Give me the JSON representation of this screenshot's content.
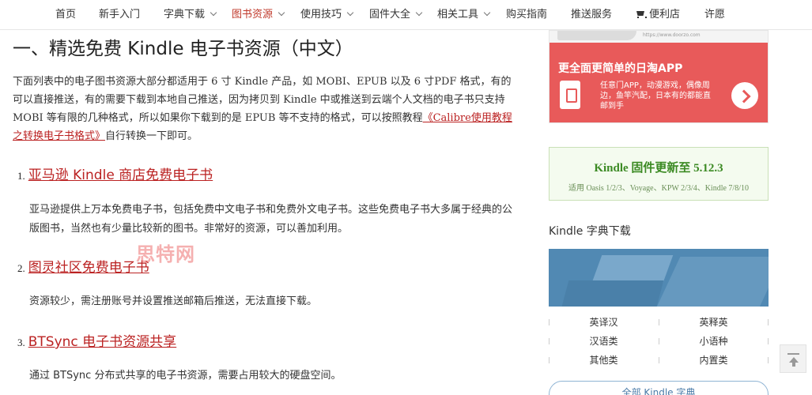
{
  "nav": {
    "items": [
      {
        "label": "首页",
        "dropdown": false,
        "active": false
      },
      {
        "label": "新手入门",
        "dropdown": false,
        "active": false
      },
      {
        "label": "字典下载",
        "dropdown": true,
        "active": false
      },
      {
        "label": "图书资源",
        "dropdown": true,
        "active": true
      },
      {
        "label": "使用技巧",
        "dropdown": true,
        "active": false
      },
      {
        "label": "固件大全",
        "dropdown": true,
        "active": false
      },
      {
        "label": "相关工具",
        "dropdown": true,
        "active": false
      },
      {
        "label": "购买指南",
        "dropdown": false,
        "active": false
      },
      {
        "label": "推送服务",
        "dropdown": false,
        "active": false
      },
      {
        "label": "便利店",
        "dropdown": false,
        "active": false,
        "icon": "cart-icon"
      },
      {
        "label": "许愿",
        "dropdown": false,
        "active": false
      }
    ]
  },
  "article": {
    "heading": "一、精选免费 Kindle 电子书资源（中文）",
    "intro_1": "下面列表中的电子图书资源大部分都适用于 6 寸 Kindle 产品，如 MOBI、EPUB 以及 6 寸PDF 格式，有的可以直接推送，有的需要下载到本地自己推送，因为拷贝到 Kindle 中或推送到云端个人文档的电子书只支持 MOBI 等有限的几种格式，所以如果你下载到的是 EPUB 等不支持的格式，可以按照教程",
    "intro_link": "《Calibre使用教程之转换电子书格式》",
    "intro_2": "自行转换一下即可。",
    "sections": [
      {
        "num": "1.",
        "title": "亚马逊 Kindle 商店免费电子书",
        "body": "亚马逊提供上万本免费电子书，包括免费中文电子书和免费外文电子书。这些免费电子书大多属于经典的公版图书，当然也有少量比较新的图书。非常好的资源，可以善加利用。"
      },
      {
        "num": "2.",
        "title": "图灵社区免费电子书",
        "body": "资源较少，需注册账号并设置推送邮箱后推送，无法直接下载。"
      },
      {
        "num": "3.",
        "title": "BTSync 电子书资源共享",
        "body": "通过 BTSync 分布式共享的电子书资源，需要占用较大的硬盘空间。"
      }
    ],
    "watermark": "思特网"
  },
  "sidebar": {
    "ad": {
      "top_url": "https://www.doorzo.com",
      "title": "更全面更简单的日淘APP",
      "desc": "任意门APP，动漫游戏，偶像周边，鱼竿汽配，日本有的都能直邮到手",
      "accent": "#e85a5a"
    },
    "firmware": {
      "title": "Kindle 固件更新至 5.12.3",
      "subtitle": "适用 Oasis 1/2/3、Voyage、KPW 2/3/4、Kindle 7/8/10"
    },
    "dict": {
      "heading": "Kindle 字典下载",
      "items": [
        "英译汉",
        "英释英",
        "汉语类",
        "小语种",
        "其他类",
        "内置类"
      ],
      "all_button": "全部 Kindle 字典"
    }
  }
}
